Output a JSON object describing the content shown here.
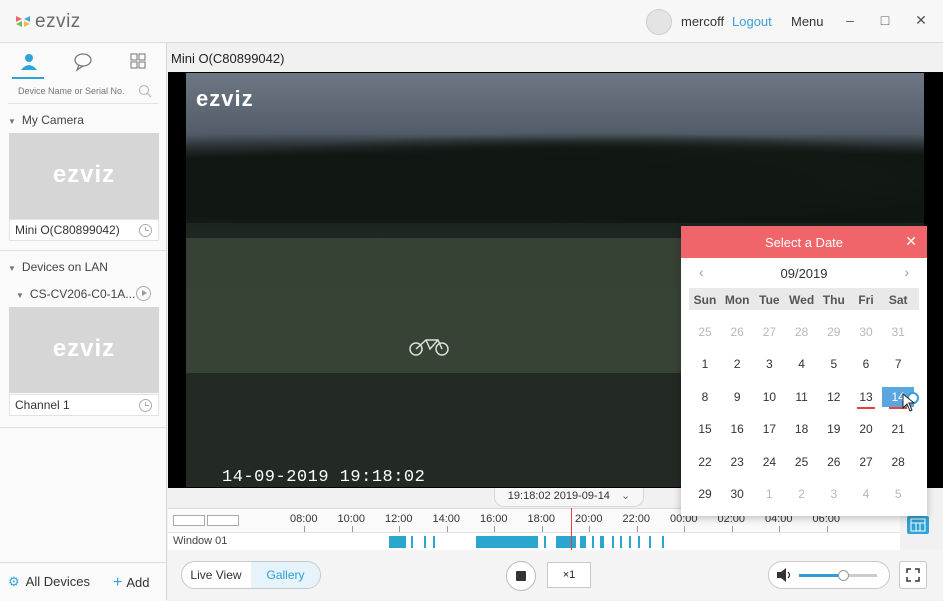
{
  "app": {
    "logo_text": "ezviz"
  },
  "header": {
    "username": "mercoff",
    "logout_label": "Logout",
    "menu_label": "Menu",
    "minimize": "–",
    "maximize": "□",
    "close": "✕"
  },
  "sidebar": {
    "search_placeholder": "Device Name or Serial No.",
    "my_camera_label": "My Camera",
    "my_camera_device": {
      "thumb_logo": "ezviz",
      "name": "Mini O(C80899042)"
    },
    "lan_label": "Devices on LAN",
    "lan_device_name": "CS-CV206-C0-1A...",
    "lan_channel": {
      "thumb_logo": "ezviz",
      "name": "Channel 1"
    },
    "all_devices_label": "All Devices",
    "add_label": "Add"
  },
  "main": {
    "camera_title": "Mini O(C80899042)",
    "overlay_logo": "ezviz",
    "overlay_timestamp": "14-09-2019 19:18:02",
    "timestamp_pill": "19:18:02 2019-09-14",
    "timeline_ticks": [
      "08:00",
      "10:00",
      "12:00",
      "14:00",
      "16:00",
      "18:00",
      "20:00",
      "22:00",
      "00:00",
      "02:00",
      "04:00",
      "06:00"
    ],
    "track_label": "Window 01"
  },
  "controls": {
    "live_view": "Live View",
    "gallery": "Gallery",
    "speed": "×1",
    "volume": 0.55
  },
  "datepicker": {
    "title": "Select a Date",
    "month": "09/2019",
    "weekdays": [
      "Sun",
      "Mon",
      "Tue",
      "Wed",
      "Thu",
      "Fri",
      "Sat"
    ],
    "weeks": [
      [
        {
          "d": "25",
          "o": true
        },
        {
          "d": "26",
          "o": true
        },
        {
          "d": "27",
          "o": true
        },
        {
          "d": "28",
          "o": true
        },
        {
          "d": "29",
          "o": true
        },
        {
          "d": "30",
          "o": true
        },
        {
          "d": "31",
          "o": true
        }
      ],
      [
        {
          "d": "1"
        },
        {
          "d": "2"
        },
        {
          "d": "3"
        },
        {
          "d": "4"
        },
        {
          "d": "5"
        },
        {
          "d": "6"
        },
        {
          "d": "7"
        }
      ],
      [
        {
          "d": "8"
        },
        {
          "d": "9"
        },
        {
          "d": "10"
        },
        {
          "d": "11"
        },
        {
          "d": "12"
        },
        {
          "d": "13",
          "rec": true
        },
        {
          "d": "14",
          "rec": true,
          "sel": true
        }
      ],
      [
        {
          "d": "15"
        },
        {
          "d": "16"
        },
        {
          "d": "17"
        },
        {
          "d": "18"
        },
        {
          "d": "19"
        },
        {
          "d": "20"
        },
        {
          "d": "21"
        }
      ],
      [
        {
          "d": "22"
        },
        {
          "d": "23"
        },
        {
          "d": "24"
        },
        {
          "d": "25"
        },
        {
          "d": "26"
        },
        {
          "d": "27"
        },
        {
          "d": "28"
        }
      ],
      [
        {
          "d": "29"
        },
        {
          "d": "30"
        },
        {
          "d": "1",
          "o": true
        },
        {
          "d": "2",
          "o": true
        },
        {
          "d": "3",
          "o": true
        },
        {
          "d": "4",
          "o": true
        },
        {
          "d": "5",
          "o": true
        }
      ]
    ]
  },
  "colors": {
    "accent": "#2fa4d8",
    "datepicker_header": "#f0656a",
    "record": "#e8403c"
  }
}
